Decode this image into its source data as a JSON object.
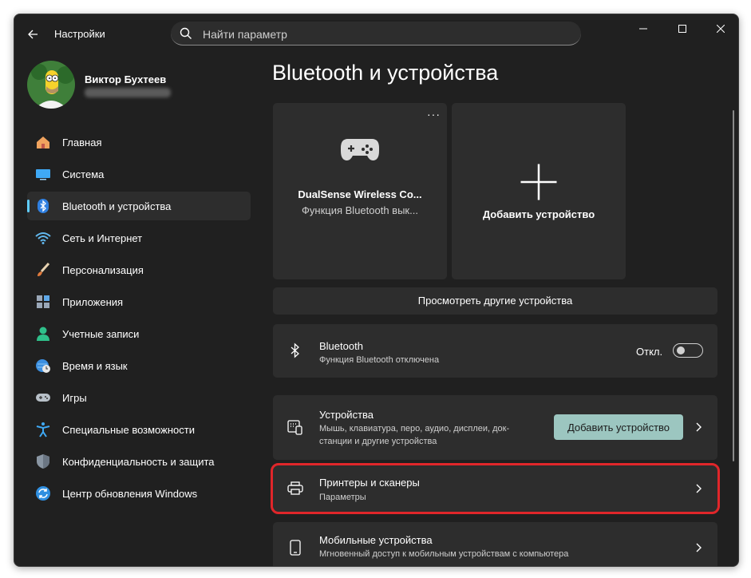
{
  "titlebar": {
    "app_title": "Настройки",
    "search_placeholder": "Найти параметр"
  },
  "profile": {
    "name": "Виктор Бухтеев"
  },
  "sidebar": {
    "items": [
      {
        "label": "Главная",
        "icon": "home-icon"
      },
      {
        "label": "Система",
        "icon": "monitor-icon"
      },
      {
        "label": "Bluetooth и устройства",
        "icon": "bluetooth-icon",
        "active": true
      },
      {
        "label": "Сеть и Интернет",
        "icon": "wifi-icon"
      },
      {
        "label": "Персонализация",
        "icon": "brush-icon"
      },
      {
        "label": "Приложения",
        "icon": "apps-icon"
      },
      {
        "label": "Учетные записи",
        "icon": "person-icon"
      },
      {
        "label": "Время и язык",
        "icon": "globe-clock-icon"
      },
      {
        "label": "Игры",
        "icon": "gamepad-icon"
      },
      {
        "label": "Специальные возможности",
        "icon": "accessibility-icon"
      },
      {
        "label": "Конфиденциальность и защита",
        "icon": "shield-icon"
      },
      {
        "label": "Центр обновления Windows",
        "icon": "update-icon"
      }
    ]
  },
  "main": {
    "title": "Bluetooth и устройства",
    "device_tile": {
      "name": "DualSense Wireless Co...",
      "status": "Функция Bluetooth вык...",
      "more": "···"
    },
    "add_tile": {
      "label": "Добавить устройство"
    },
    "more_devices_label": "Просмотреть другие устройства",
    "bluetooth_card": {
      "title": "Bluetooth",
      "subtitle": "Функция Bluetooth отключена",
      "toggle_label": "Откл.",
      "toggle_on": false
    },
    "devices_card": {
      "title": "Устройства",
      "subtitle_line1": "Мышь, клавиатура, перо, аудио, дисплеи, док-",
      "subtitle_line2": "станции и другие устройства",
      "button_label": "Добавить устройство"
    },
    "printers_card": {
      "title": "Принтеры и сканеры",
      "subtitle": "Параметры"
    },
    "mobile_card": {
      "title": "Мобильные устройства",
      "subtitle": "Мгновенный доступ к мобильным устройствам с компьютера"
    }
  },
  "colors": {
    "accent": "#60cdff",
    "highlight": "#e0262a",
    "button": "#9cc6c0",
    "background": "#202020",
    "card": "#2d2d2d"
  }
}
